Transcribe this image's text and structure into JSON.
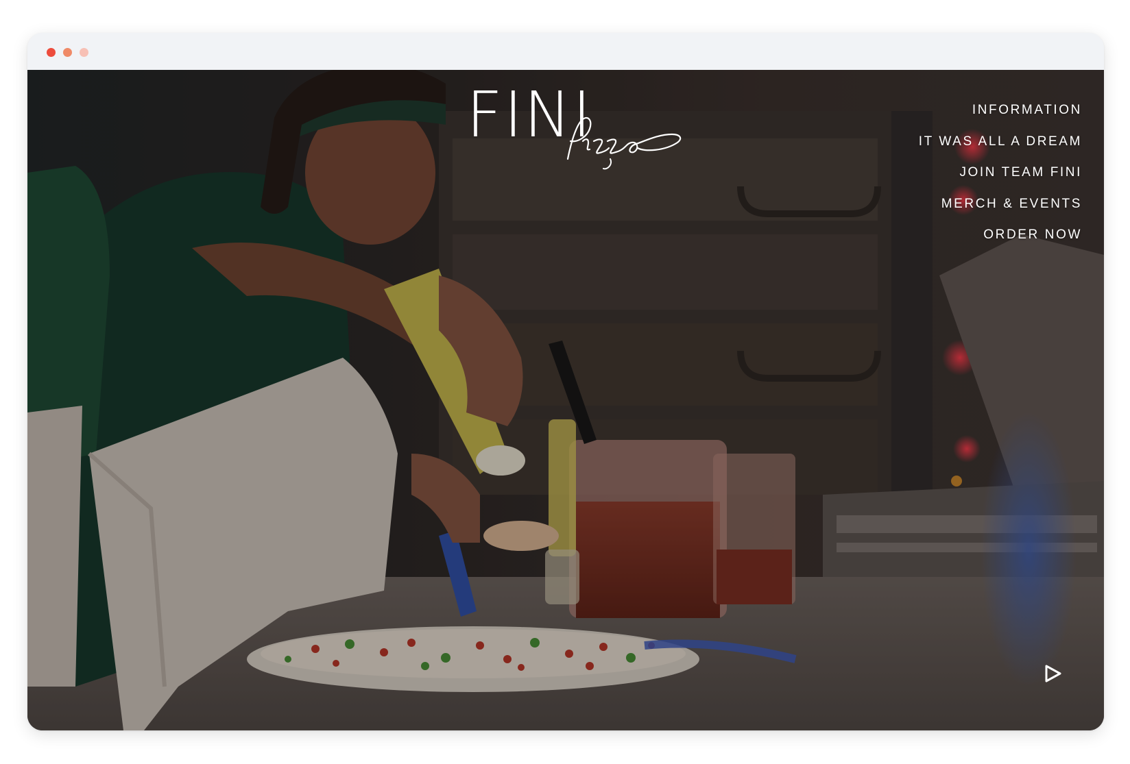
{
  "window": {
    "controls": [
      {
        "name": "close",
        "color": "#ed4c3c"
      },
      {
        "name": "minimize",
        "color": "#ef8a67"
      },
      {
        "name": "maximize",
        "color": "#f7c0b5"
      }
    ]
  },
  "brand": {
    "wordmark": "FINI",
    "script": "Pizza"
  },
  "nav": {
    "items": [
      {
        "label": "INFORMATION"
      },
      {
        "label": "IT WAS ALL A DREAM"
      },
      {
        "label": "JOIN TEAM FINI"
      },
      {
        "label": "MERCH & EVENTS"
      },
      {
        "label": "ORDER NOW"
      }
    ]
  },
  "hero": {
    "media": "video of a pizza maker drizzling oil over a pizza in a kitchen",
    "play_icon": "play-icon"
  },
  "colors": {
    "text": "#ffffff",
    "chrome": "#f1f3f6"
  }
}
